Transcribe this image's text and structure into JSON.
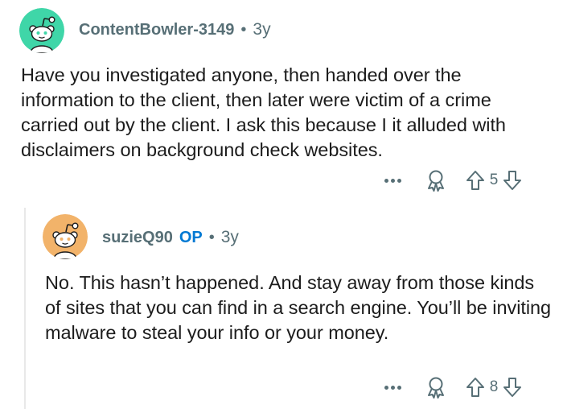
{
  "comments": [
    {
      "username": "ContentBowler-3149",
      "separator": "•",
      "time": "3y",
      "body": "Have you investigated anyone, then handed over the information to the client, then later were victim of a crime carried out by the client. I ask this because I it alluded with disclaimers on background check websites.",
      "votes": "5",
      "avatar_color": "#3fd6a8"
    },
    {
      "username": "suzieQ90",
      "op_label": "OP",
      "separator": "•",
      "time": "3y",
      "body": "No. This hasn’t happened. And stay away from those kinds of sites that you can find in a search engine. You’ll be inviting malware to steal your info or your money.",
      "votes": "8",
      "avatar_color": "#f2b36a"
    }
  ],
  "colors": {
    "meta_gray": "#576f76",
    "op_blue": "#0079d3",
    "text": "#1c1c1c"
  },
  "icons": {
    "more": "more-options-icon",
    "award": "award-icon",
    "upvote": "upvote-arrow-icon",
    "downvote": "downvote-arrow-icon",
    "avatar": "snoo-avatar-icon"
  }
}
